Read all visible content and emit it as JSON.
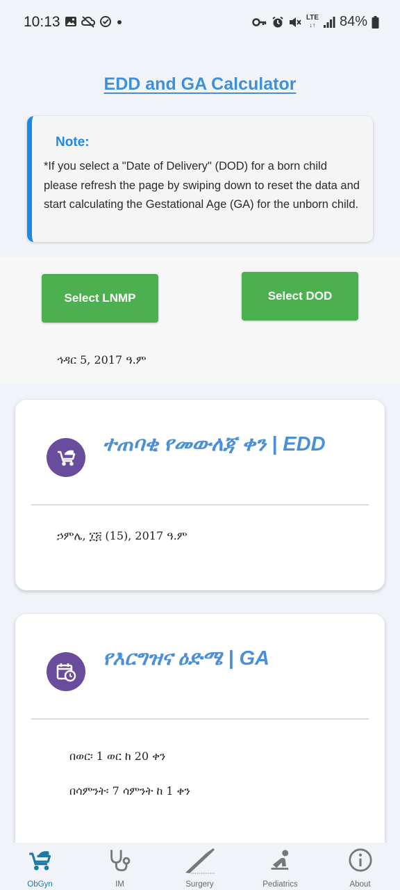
{
  "status_bar": {
    "time": "10:13",
    "battery": "84%",
    "network": "LTE"
  },
  "page": {
    "title": "EDD and GA Calculator"
  },
  "note": {
    "title": "Note:",
    "text": "*If you select a \"Date of Delivery\" (DOD) for a born child please refresh the page by swiping down to reset the data and start calculating the Gestational Age (GA) for the unborn child."
  },
  "selection": {
    "lnmp_button": "Select LNMP",
    "dod_button": "Select DOD",
    "selected_date": "ኅዳር 5, 2017 ዓ.ም"
  },
  "edd_card": {
    "title": "ተጠባቂ የመውለጃ ቀን | EDD",
    "value": "ኃምሌ, ፲፭ (15), 2017 ዓ.ም"
  },
  "ga_card": {
    "title": "የእርግዝና ዕድሜ | GA",
    "months": "በወር፡ 1 ወር ከ 20 ቀን",
    "weeks": "በሳምንት፡ 7 ሳምንት ከ 1 ቀን"
  },
  "nav": {
    "items": [
      {
        "label": "ObGyn",
        "icon": "stroller-icon",
        "active": true
      },
      {
        "label": "IM",
        "icon": "stethoscope-icon",
        "active": false
      },
      {
        "label": "Surgery",
        "icon": "scalpel-icon",
        "active": false
      },
      {
        "label": "Pediatrics",
        "icon": "child-icon",
        "active": false
      },
      {
        "label": "About",
        "icon": "info-icon",
        "active": false
      }
    ]
  },
  "colors": {
    "accent": "#3f8fd9",
    "button": "#4caf50",
    "icon_circle": "#6a4c9c",
    "note_border": "#1e88e5",
    "nav_active": "#1e7aa3"
  }
}
